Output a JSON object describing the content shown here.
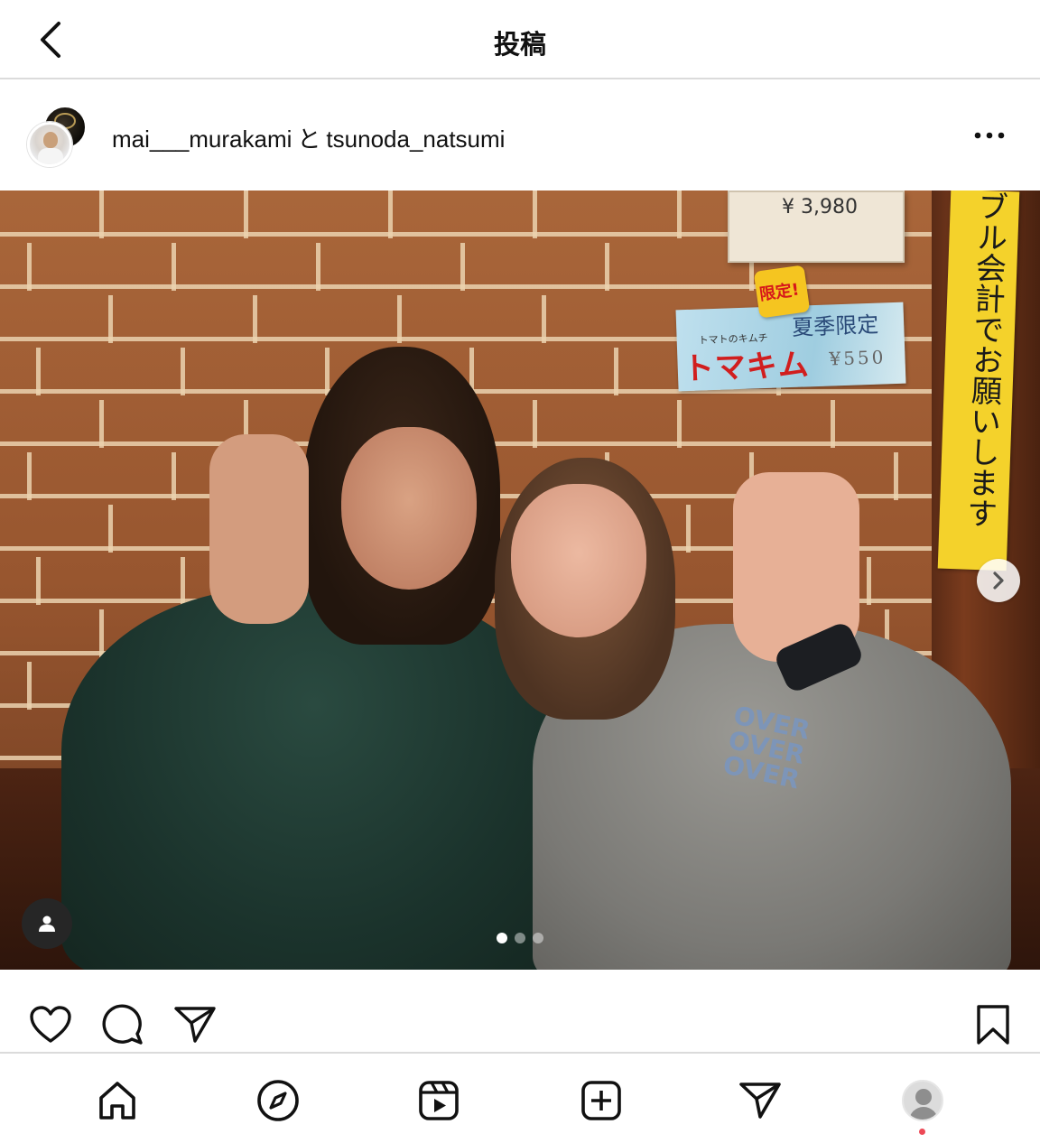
{
  "header": {
    "title": "投稿"
  },
  "post": {
    "user1": "mai___murakami",
    "conjunction": "と",
    "user2": "tsunoda_natsumi"
  },
  "photo": {
    "price_card_text": "¥ 3,980",
    "limited_badge": "限定!",
    "seasonal_label": "夏季限定",
    "menu_sub": "トマトのキムチ",
    "menu_item": "トマキム",
    "menu_price": "¥550",
    "banner_text": "ブル会計でお願いします",
    "shirt_print": "OVER OVER OVER",
    "carousel": {
      "count": 3,
      "active": 0
    }
  },
  "icons": {
    "back": "chevron-left-icon",
    "more": "more-horizontal-icon",
    "next": "chevron-right-icon",
    "tag": "user-tag-icon",
    "like": "heart-icon",
    "comment": "comment-icon",
    "share": "send-icon",
    "save": "bookmark-icon",
    "home": "home-icon",
    "explore": "compass-icon",
    "reels": "reels-icon",
    "create": "plus-square-icon",
    "messages": "send-icon",
    "profile": "profile-avatar-icon"
  },
  "colors": {
    "notification": "#ed4956",
    "divider": "#dbdbdb",
    "text": "#111111"
  }
}
